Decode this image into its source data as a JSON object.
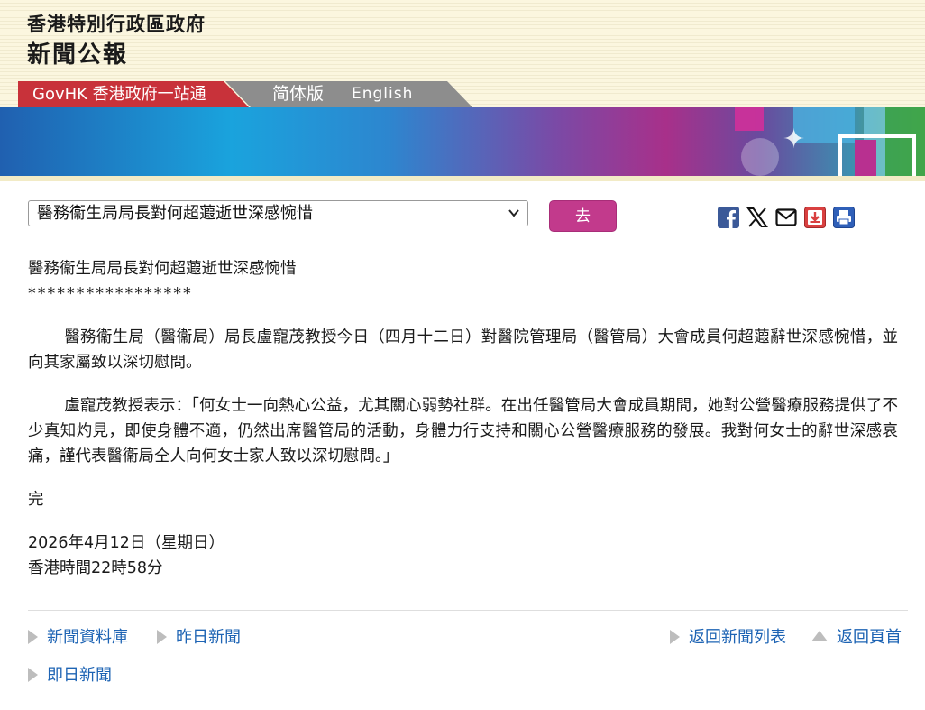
{
  "header": {
    "gov_name": "香港特別行政區政府",
    "site_name": "新聞公報"
  },
  "tabs": {
    "govhk": "GovHK 香港政府一站通",
    "simplified": "简体版",
    "english": "English"
  },
  "controls": {
    "select_value": "醫務衞生局局長對何超蕸逝世深感惋惜",
    "go_label": "去"
  },
  "share_icons": [
    "facebook-icon",
    "x-icon",
    "mail-icon",
    "download-icon",
    "print-icon"
  ],
  "article": {
    "title": "醫務衞生局局長對何超蕸逝世深感惋惜",
    "stars": "*****************",
    "para1": "醫務衞生局（醫衞局）局長盧寵茂教授今日（四月十二日）對醫院管理局（醫管局）大會成員何超蕸辭世深感惋惜，並向其家屬致以深切慰問。",
    "para2": "盧寵茂教授表示：「何女士一向熱心公益，尤其關心弱勢社群。在出任醫管局大會成員期間，她對公營醫療服務提供了不少真知灼見，即使身體不適，仍然出席醫管局的活動，身體力行支持和關心公營醫療服務的發展。我對何女士的辭世深感哀痛，謹代表醫衞局仝人向何女士家人致以深切慰問。」",
    "end_mark": "完",
    "date": "2026年4月12日（星期日）",
    "time": "香港時間22時58分"
  },
  "footer": {
    "archive": "新聞資料庫",
    "yesterday": "昨日新聞",
    "back_list": "返回新聞列表",
    "back_top": "返回頁首",
    "today": "即日新聞"
  },
  "colors": {
    "govhk_tab": "#c8323a",
    "go_button": "#c23a8c",
    "link": "#1e64b4"
  }
}
